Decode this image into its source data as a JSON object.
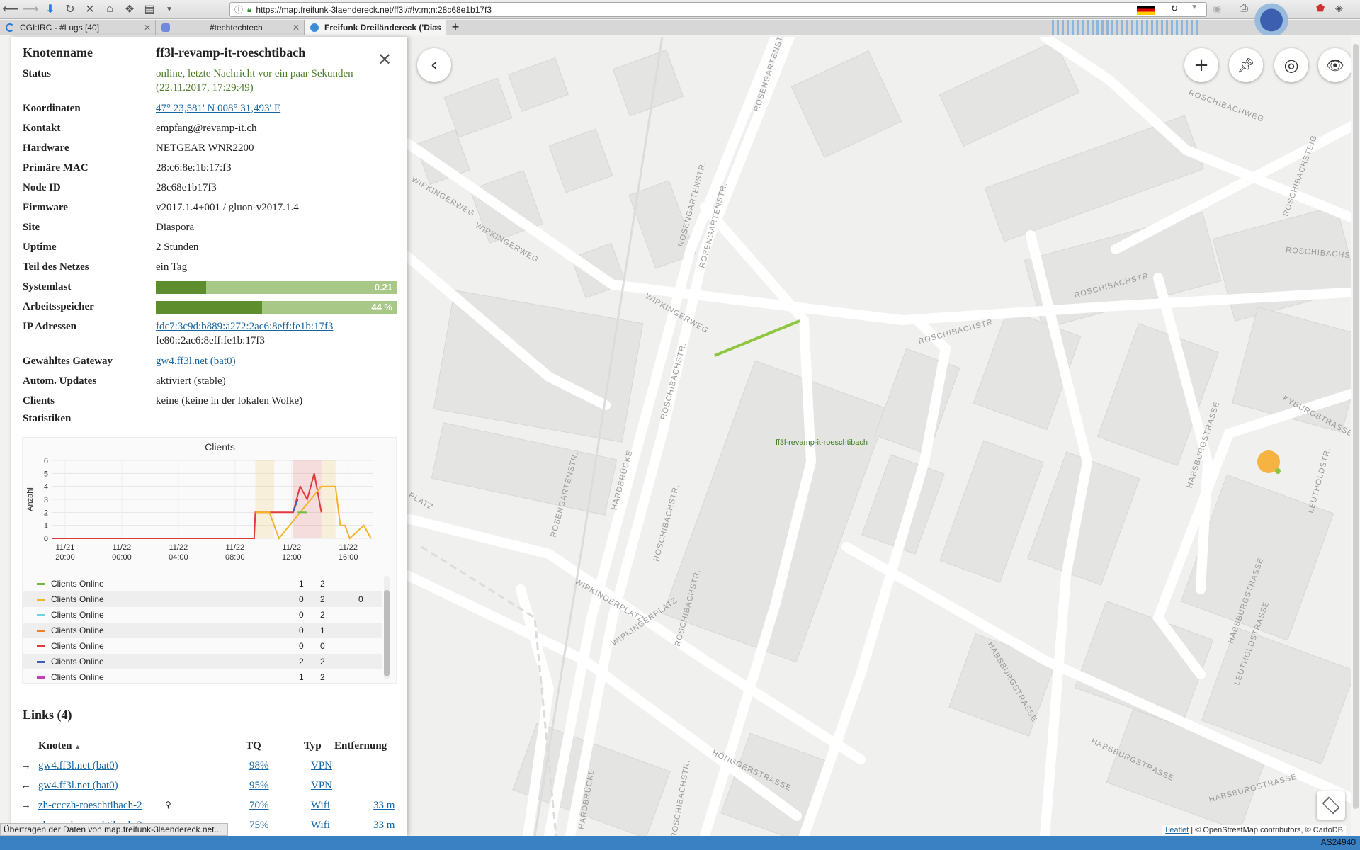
{
  "browser": {
    "url": "https://map.freifunk-3laendereck.net/ff3l/#!v:m;n:28c68e1b17f3",
    "tabs": [
      {
        "label": "CGI:IRC - #Lugs [40]"
      },
      {
        "label": "#techtechtech"
      },
      {
        "label": "Freifunk Dreiländereck ('Dias"
      }
    ],
    "status_text": "Übertragen der Daten von map.freifunk-3laendereck.net...",
    "as_label": "AS24940"
  },
  "node": {
    "name_label": "Knotenname",
    "name_value": "ff3l-revamp-it-roeschtibach",
    "status_label": "Status",
    "status_value": "online, letzte Nachricht vor ein paar Sekunden (22.11.2017, 17:29:49)",
    "coords_label": "Koordinaten",
    "coords_value": "47° 23,581' N 008° 31,493' E",
    "contact_label": "Kontakt",
    "contact_value": "empfang@revamp-it.ch",
    "hardware_label": "Hardware",
    "hardware_value": "NETGEAR WNR2200",
    "mac_label": "Primäre MAC",
    "mac_value": "28:c6:8e:1b:17:f3",
    "nodeid_label": "Node ID",
    "nodeid_value": "28c68e1b17f3",
    "firmware_label": "Firmware",
    "firmware_value": "v2017.1.4+001 / gluon-v2017.1.4",
    "site_label": "Site",
    "site_value": "Diaspora",
    "uptime_label": "Uptime",
    "uptime_value": "2 Stunden",
    "network_label": "Teil des Netzes",
    "network_value": "ein Tag",
    "load_label": "Systemlast",
    "load_value": "0.21",
    "load_fraction": 0.21,
    "memory_label": "Arbeitsspeicher",
    "memory_value": "44 %",
    "memory_fraction": 0.44,
    "ip_label": "IP Adressen",
    "ip_value_1": "fdc7:3c9d:b889:a272:2ac6:8eff:fe1b:17f3",
    "ip_value_2": "fe80::2ac6:8eff:fe1b:17f3",
    "gateway_label": "Gewähltes Gateway",
    "gateway_value": "gw4.ff3l.net (bat0)",
    "updates_label": "Autom. Updates",
    "updates_value": "aktiviert (stable)",
    "clients_label": "Clients",
    "clients_value": "keine (keine in der lokalen Wolke)",
    "stats_label": "Statistiken"
  },
  "chart_data": {
    "type": "line",
    "title": "Clients",
    "ylabel": "Anzahl",
    "xlabel": "",
    "ylim": [
      0,
      6
    ],
    "yticks": [
      0,
      1,
      2,
      3,
      4,
      5,
      6
    ],
    "xticks": [
      "11/21 20:00",
      "11/22 00:00",
      "11/22 04:00",
      "11/22 08:00",
      "11/22 12:00",
      "11/22 16:00"
    ],
    "xtick_dates": [
      "11/21",
      "11/22",
      "11/22",
      "11/22",
      "11/22",
      "11/22"
    ],
    "xtick_times": [
      "20:00",
      "00:00",
      "04:00",
      "08:00",
      "12:00",
      "16:00"
    ],
    "series": [
      {
        "name": "Clients Online",
        "color": "#6cbf3c",
        "legend_values": [
          "1",
          "2",
          ""
        ]
      },
      {
        "name": "Clients Online",
        "color": "#f0b429",
        "legend_values": [
          "0",
          "2",
          "0"
        ]
      },
      {
        "name": "Clients Online",
        "color": "#6dd3e0",
        "legend_values": [
          "0",
          "2",
          ""
        ]
      },
      {
        "name": "Clients Online",
        "color": "#f07f2a",
        "legend_values": [
          "0",
          "1",
          ""
        ]
      },
      {
        "name": "Clients Online",
        "color": "#e03a3a",
        "legend_values": [
          "0",
          "0",
          ""
        ]
      },
      {
        "name": "Clients Online",
        "color": "#3b5fb5",
        "legend_values": [
          "2",
          "2",
          ""
        ]
      },
      {
        "name": "Clients Online",
        "color": "#c43fb5",
        "legend_values": [
          "1",
          "2",
          ""
        ]
      }
    ],
    "lines": [
      {
        "color": "#e03a3a",
        "x": [
          "11/21 19:00",
          "11/22 09:15",
          "11/22 09:20",
          "11/22 12:00",
          "11/22 12:30",
          "11/22 13:00",
          "11/22 13:30",
          "11/22 14:00"
        ],
        "y": [
          0,
          0,
          2,
          2,
          4,
          3,
          5,
          2
        ]
      },
      {
        "color": "#f0b429",
        "x": [
          "11/22 09:20",
          "11/22 10:20",
          "11/22 10:40",
          "11/22 11:00",
          "11/22 14:00",
          "11/22 15:00",
          "11/22 15:20",
          "11/22 15:40",
          "11/22 16:00",
          "11/22 17:00",
          "11/22 17:30"
        ],
        "y": [
          2,
          2,
          1,
          0,
          4,
          4,
          1,
          1,
          0,
          1,
          0
        ]
      },
      {
        "color": "#3b5fb5",
        "x": [
          "11/22 12:00",
          "11/22 12:20"
        ],
        "y": [
          2,
          3
        ]
      },
      {
        "color": "#6cbf3c",
        "x": [
          "11/22 12:20",
          "11/22 13:00"
        ],
        "y": [
          2,
          2
        ]
      }
    ]
  },
  "legend_scroll_visible": true,
  "links": {
    "heading": "Links (4)",
    "col_node": "Knoten",
    "col_tq": "TQ",
    "col_type": "Typ",
    "col_distance": "Entfernung",
    "rows": [
      {
        "arrow": "→",
        "node": "gw4.ff3l.net (bat0)",
        "tq": "98%",
        "type": "VPN",
        "distance": ""
      },
      {
        "arrow": "←",
        "node": "gw4.ff3l.net (bat0)",
        "tq": "95%",
        "type": "VPN",
        "distance": ""
      },
      {
        "arrow": "→",
        "node": "zh-ccczh-roeschtibach-2",
        "tq": "70%",
        "type": "Wifi",
        "distance": "33 m"
      },
      {
        "arrow": "←",
        "node": "zh-ccczh-roeschtibach-2",
        "tq": "75%",
        "type": "Wifi",
        "distance": "33 m"
      }
    ]
  },
  "map": {
    "node_main": "ff3l-revamp-it-roeschtibach",
    "node_peer": "zh-ccczh-roeschtibach-2",
    "attribution_leaflet": "Leaflet",
    "attribution_rest": "| © OpenStreetMap contributors, © CartoDB",
    "streets": [
      "ROSENGARTENSTR.",
      "ROSCHIBACHWEG",
      "WIPKINGERWEG",
      "WIPKINGERWEG",
      "WIPKINGERWEG",
      "ROSENGARTENSTR.",
      "ROSCHIBACHSTR.",
      "ROSCHIBACHSTR.",
      "ROSCHIBACHSTR.",
      "ROSCHIBACHSTEIG",
      "ROSCHIBACHSTR.",
      "KYBURGSTRASSE",
      "HABSBURGSTRASSE",
      "ROSENGARTENSTR.",
      "HARDBRÜCKE",
      "ROSCHIBACHSTR.",
      "WIPKINGERPLATZ",
      "WIPKINGERPLATZ",
      "ROSCHIBACHSTR.",
      "HABSBURGSTRASSE",
      "LEUTHOLDSTRASSE",
      "HABSBURGSTRASSE",
      "HÖNGGERSTRASSE",
      "HARDBRÜCKE",
      "ROSCHIBACHSTR.",
      "HABSBURGSTRASSE",
      "HABSBURGSTRASSE",
      "LEUTHOLDSTR.",
      "ROSENGARTENSTR.",
      "PLATZ"
    ]
  },
  "colors": {
    "accent": "#1566a4",
    "online": "#4d7d2b",
    "bar_fill": "#5e8d2e",
    "bar_bg": "#a8c888",
    "link_line": "#8ec63f",
    "node_highlight": "#f7a823"
  }
}
